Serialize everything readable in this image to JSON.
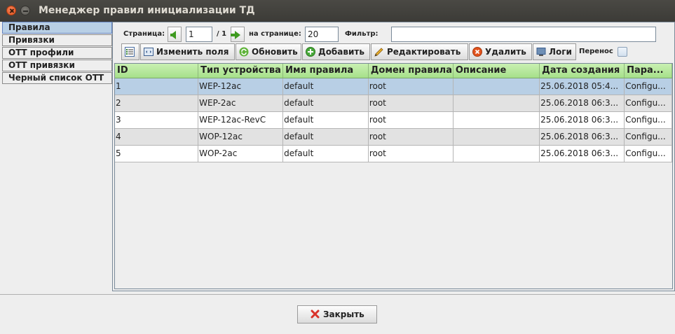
{
  "window": {
    "title": "Менеджер правил инициализации ТД"
  },
  "tabs": [
    {
      "label": "Правила",
      "active": true
    },
    {
      "label": "Привязки",
      "active": false
    },
    {
      "label": "ОТТ профили",
      "active": false
    },
    {
      "label": "ОТТ привязки",
      "active": false
    },
    {
      "label": "Черный список ОТТ",
      "active": false
    }
  ],
  "paging": {
    "page_label": "Страница:",
    "page_value": "1",
    "page_total": "/ 1",
    "per_page_label": "на странице:",
    "per_page_value": "20",
    "filter_label": "Фильтр:",
    "filter_value": ""
  },
  "toolbar": {
    "fields_label": "Изменить поля",
    "refresh_label": "Обновить",
    "add_label": "Добавить",
    "edit_label": "Редактировать",
    "delete_label": "Удалить",
    "logs_label": "Логи",
    "wrap_label": "Перенос",
    "wrap_checked": false
  },
  "table": {
    "columns": [
      "ID",
      "Тип устройства",
      "Имя правила",
      "Домен правила",
      "Описание",
      "Дата создания",
      "Пара..."
    ],
    "rows": [
      [
        "1",
        "WEP-12ac",
        "default",
        "root",
        "",
        "25.06.2018 05:4...",
        "Configu..."
      ],
      [
        "2",
        "WEP-2ac",
        "default",
        "root",
        "",
        "25.06.2018 06:3...",
        "Configu..."
      ],
      [
        "3",
        "WEP-12ac-RevC",
        "default",
        "root",
        "",
        "25.06.2018 06:3...",
        "Configu..."
      ],
      [
        "4",
        "WOP-12ac",
        "default",
        "root",
        "",
        "25.06.2018 06:3...",
        "Configu..."
      ],
      [
        "5",
        "WOP-2ac",
        "default",
        "root",
        "",
        "25.06.2018 06:3...",
        "Configu..."
      ]
    ],
    "selected_row": 0
  },
  "footer": {
    "close_label": "Закрыть"
  },
  "colors": {
    "header_green": "#a6e08a",
    "selection_blue": "#b8cfe5",
    "icon_green": "#3e9a1f",
    "close_red": "#e2531d"
  }
}
